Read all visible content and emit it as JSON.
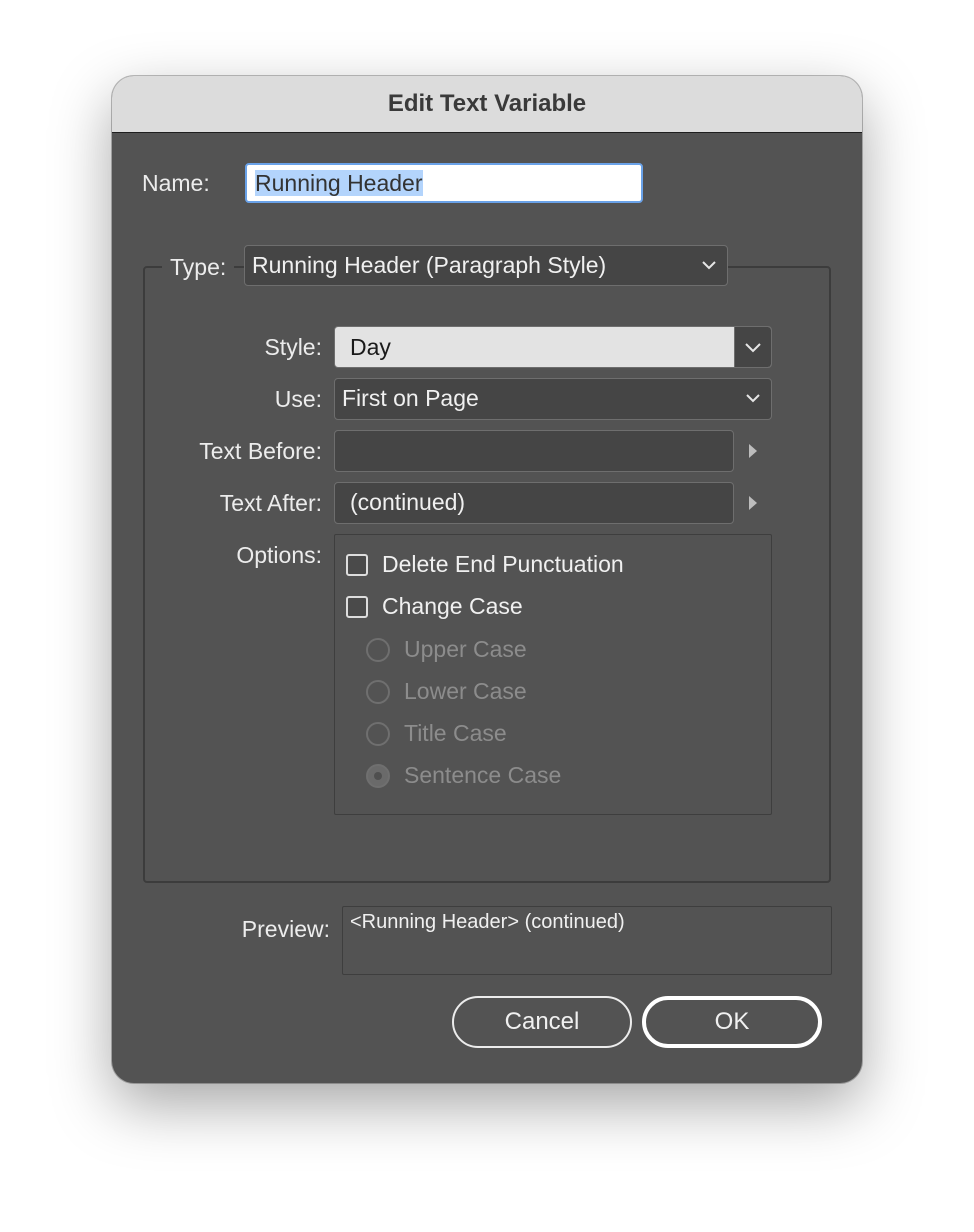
{
  "dialog": {
    "title": "Edit Text Variable"
  },
  "name": {
    "label": "Name:",
    "value": "Running Header"
  },
  "type": {
    "label": "Type:",
    "value": "Running Header (Paragraph Style)"
  },
  "style": {
    "label": "Style:",
    "value": "Day"
  },
  "use": {
    "label": "Use:",
    "value": "First on Page"
  },
  "text_before": {
    "label": "Text Before:",
    "value": ""
  },
  "text_after": {
    "label": "Text After:",
    "value": "(continued)"
  },
  "options": {
    "label": "Options:",
    "delete_end_punctuation": {
      "label": "Delete End Punctuation",
      "checked": false
    },
    "change_case": {
      "label": "Change Case",
      "checked": false
    },
    "case_choices": [
      {
        "label": "Upper Case",
        "selected": false,
        "enabled": false
      },
      {
        "label": "Lower Case",
        "selected": false,
        "enabled": false
      },
      {
        "label": "Title Case",
        "selected": false,
        "enabled": false
      },
      {
        "label": "Sentence Case",
        "selected": true,
        "enabled": false
      }
    ]
  },
  "preview": {
    "label": "Preview:",
    "value": "<Running Header> (continued)"
  },
  "buttons": {
    "cancel": "Cancel",
    "ok": "OK"
  },
  "colors": {
    "dialog_bg": "#535353",
    "titlebar_bg": "#dcdcdc",
    "focus_ring": "#6aa2e8",
    "selection": "#b3d4fc"
  }
}
